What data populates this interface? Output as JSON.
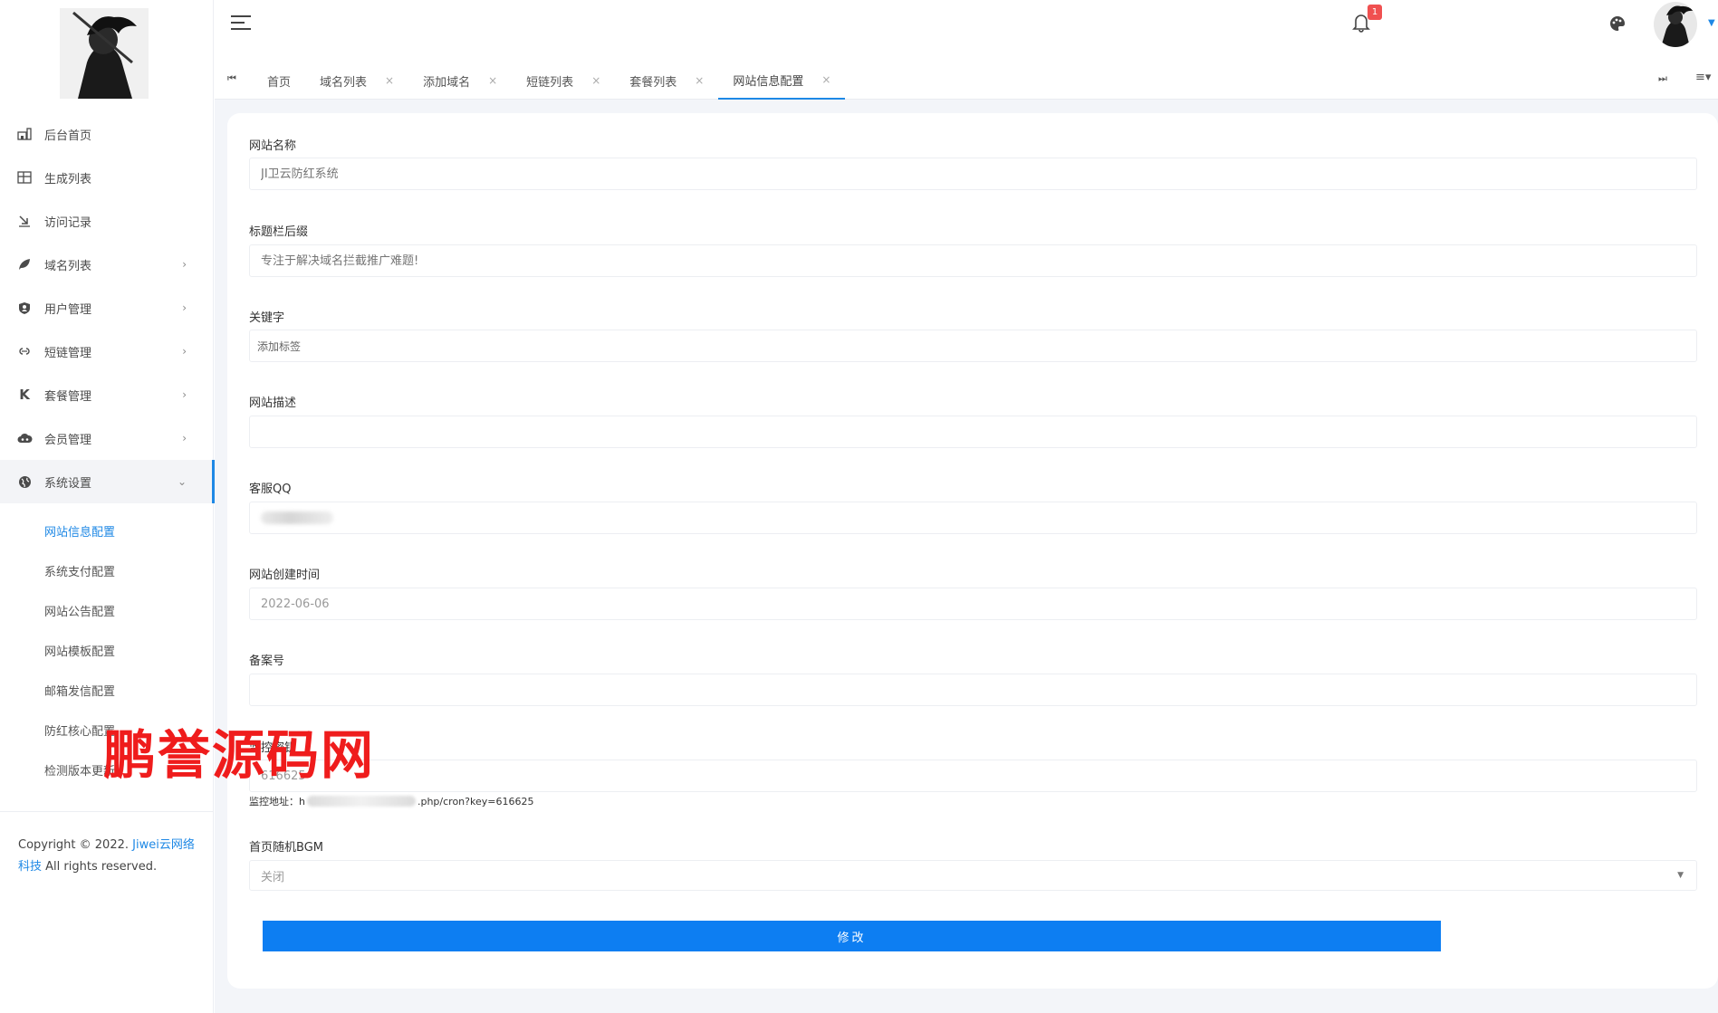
{
  "sidebar": {
    "menu": [
      {
        "label": "后台首页",
        "icon": "home-chart-icon",
        "has_arrow": false
      },
      {
        "label": "生成列表",
        "icon": "grid-icon",
        "has_arrow": false
      },
      {
        "label": "访问记录",
        "icon": "arrow-in-icon",
        "has_arrow": false
      },
      {
        "label": "域名列表",
        "icon": "leaf-icon",
        "has_arrow": true
      },
      {
        "label": "用户管理",
        "icon": "shield-user-icon",
        "has_arrow": true
      },
      {
        "label": "短链管理",
        "icon": "chain-icon",
        "has_arrow": true
      },
      {
        "label": "套餐管理",
        "icon": "k-icon",
        "has_arrow": true
      },
      {
        "label": "会员管理",
        "icon": "cloud-icon",
        "has_arrow": true
      },
      {
        "label": "系统设置",
        "icon": "globe-icon",
        "has_arrow": true,
        "expanded": true
      }
    ],
    "arrow_right": "›",
    "arrow_down": "⌄",
    "submenu": [
      {
        "label": "网站信息配置",
        "current": true
      },
      {
        "label": "系统支付配置"
      },
      {
        "label": "网站公告配置"
      },
      {
        "label": "网站模板配置"
      },
      {
        "label": "邮箱发信配置"
      },
      {
        "label": "防红核心配置"
      },
      {
        "label": "检测版本更新"
      }
    ],
    "copyright_prefix": "Copyright © 2022. ",
    "copyright_link": "Jiwei云网络科技",
    "copyright_suffix": " All rights reserved."
  },
  "header": {
    "notification_count": "1"
  },
  "tabs": {
    "nav_left": "⏮",
    "nav_right": "⏭",
    "menu": "≡▾",
    "close_glyph": "×",
    "items": [
      {
        "label": "首页",
        "closable": false
      },
      {
        "label": "域名列表",
        "closable": true
      },
      {
        "label": "添加域名",
        "closable": true
      },
      {
        "label": "短链列表",
        "closable": true
      },
      {
        "label": "套餐列表",
        "closable": true
      },
      {
        "label": "网站信息配置",
        "closable": true,
        "active": true
      }
    ]
  },
  "form": {
    "site_name": {
      "label": "网站名称",
      "placeholder": "JI卫云防红系统"
    },
    "title_suffix": {
      "label": "标题栏后缀",
      "placeholder": "专注于解决域名拦截推广难题!"
    },
    "keywords": {
      "label": "关键字",
      "placeholder": "添加标签"
    },
    "description": {
      "label": "网站描述",
      "value": ""
    },
    "service_qq": {
      "label": "客服QQ"
    },
    "created_date": {
      "label": "网站创建时间",
      "value": "2022-06-06"
    },
    "icp": {
      "label": "备案号",
      "value": ""
    },
    "monitor_key": {
      "label": "监控密钥",
      "value": "616625"
    },
    "monitor_url_prefix": "监控地址：h",
    "monitor_url_suffix": ".php/cron?key=616625",
    "bgm": {
      "label": "首页随机BGM",
      "selected": "关闭"
    },
    "submit_label": "修改"
  },
  "watermark": "鹏誉源码网",
  "colors": {
    "accent": "#1e88e5",
    "button": "#0d7ef2",
    "badge": "#f05050",
    "watermark": "#ef1c1c"
  }
}
